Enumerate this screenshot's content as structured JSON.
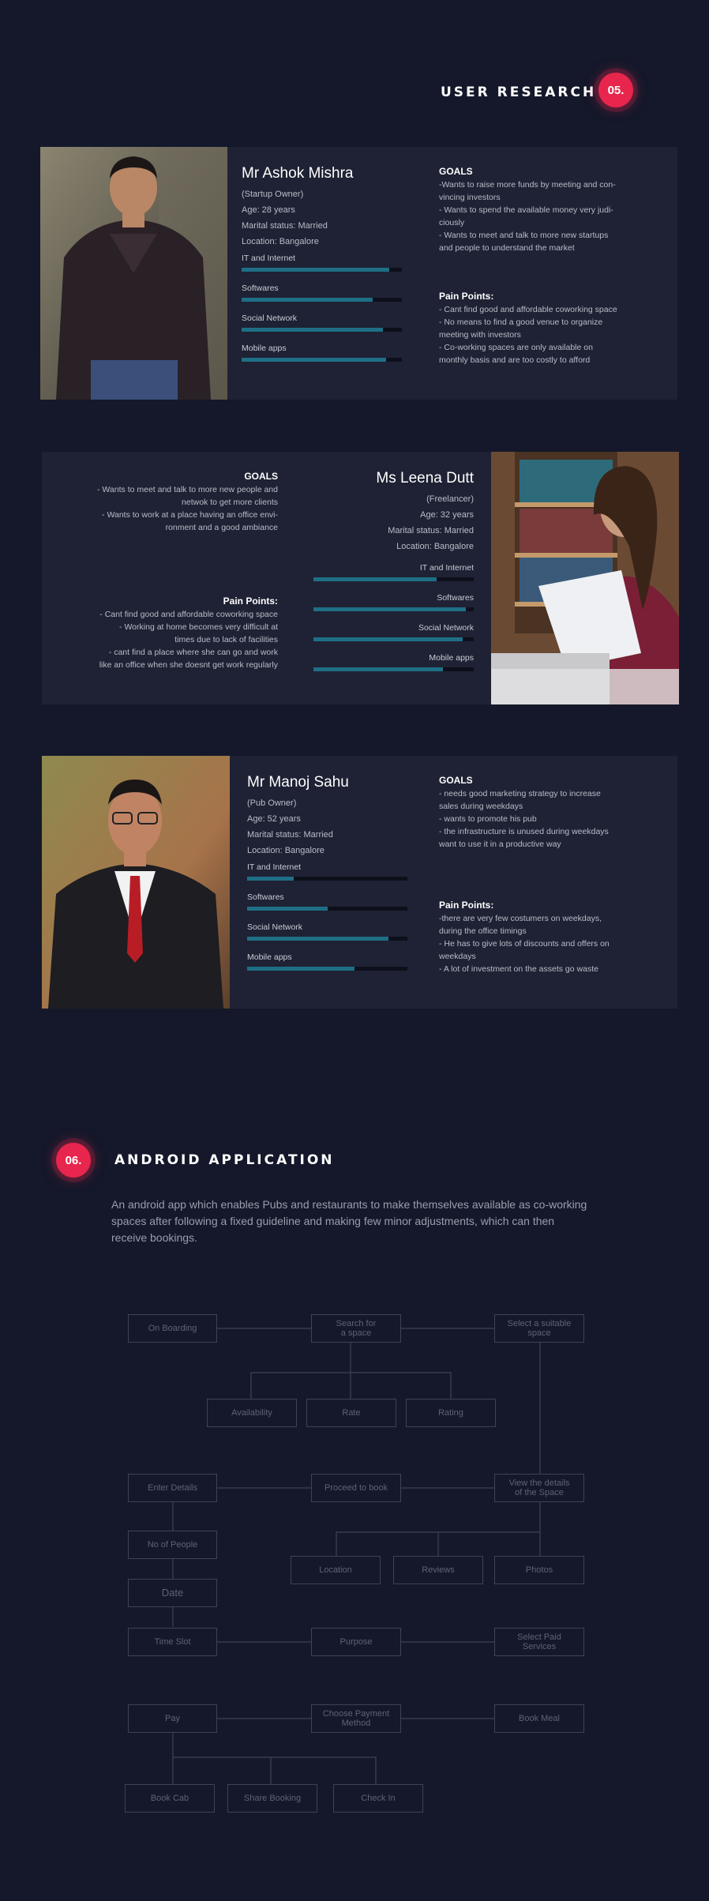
{
  "user_research": {
    "title": "USER RESEARCH",
    "number": "05.",
    "personas": [
      {
        "name": "Mr Ashok Mishra",
        "role": "(Startup Owner)",
        "age": "Age: 28 years",
        "marital": "Marital status: Married",
        "location": "Location: Bangalore",
        "skills": [
          {
            "label": "IT and Internet",
            "level": 0.92
          },
          {
            "label": "Softwares",
            "level": 0.82
          },
          {
            "label": "Social Network",
            "level": 0.88
          },
          {
            "label": "Mobile apps",
            "level": 0.9
          }
        ],
        "goals_title": "GOALS",
        "goals": "-Wants to  raise more funds by meeting and con-\nvincing investors\n- Wants to spend the available money very judi-\nciously\n- Wants to meet and talk to more new startups\nand people to understand the market",
        "pain_title": "Pain Points:",
        "pain": "- Cant find good and affordable coworking space\n- No means to find a good venue to organize\nmeeting with investors\n- Co-working spaces are only available on\nmonthly basis and are too costly to afford"
      },
      {
        "name": "Ms Leena Dutt",
        "role": "(Freelancer)",
        "age": "Age: 32 years",
        "marital": "Marital status: Married",
        "location": "Location: Bangalore",
        "skills": [
          {
            "label": "IT and Internet",
            "level": 0.77
          },
          {
            "label": "Softwares",
            "level": 0.95
          },
          {
            "label": "Social Network",
            "level": 0.93
          },
          {
            "label": "Mobile apps",
            "level": 0.81
          }
        ],
        "goals_title": "GOALS",
        "goals": "- Wants to meet and talk to more new people and\nnetwok to get more clients\n- Wants to work at a place having an office envi-\nronment  and a good ambiance",
        "pain_title": "Pain Points:",
        "pain": "- Cant find good and affordable coworking space\n- Working at home becomes very difficult at\ntimes due to lack of facilities\n- cant find a place where she can go and work\nlike an office when she doesnt get work regularly"
      },
      {
        "name": "Mr Manoj Sahu",
        "role": "(Pub Owner)",
        "age": "Age: 52 years",
        "marital": "Marital status: Married",
        "location": "Location: Bangalore",
        "skills": [
          {
            "label": "IT and Internet",
            "level": 0.29
          },
          {
            "label": "Softwares",
            "level": 0.5
          },
          {
            "label": "Social Network",
            "level": 0.88
          },
          {
            "label": "Mobile apps",
            "level": 0.67
          }
        ],
        "goals_title": "GOALS",
        "goals": "- needs good marketing strategy to increase\nsales during weekdays\n- wants to promote his pub\n- the infrastructure is unused during weekdays\nwant to use it in a productive way",
        "pain_title": "Pain Points:",
        "pain": "-there are very few costumers on weekdays,\nduring the office timings\n- He has to give lots of discounts and offers on\nweekdays\n- A lot of investment on the assets go waste"
      }
    ]
  },
  "android": {
    "number": "06.",
    "title": "ANDROID APPLICATION",
    "intro": "An android app which enables Pubs and restaurants to make themselves available as co-working spaces after following a fixed guideline and making few minor adjustments, which can then receive bookings.",
    "flow": {
      "onboarding": "On Boarding",
      "search": "Search for\na space",
      "select_space": "Select a suitable\nspace",
      "availability": "Availability",
      "rate": "Rate",
      "rating": "Rating",
      "enter_details": "Enter Details",
      "proceed": "Proceed to book",
      "view_details": "View the details\nof the Space",
      "people": "No of People",
      "location": "Location",
      "reviews": "Reviews",
      "photos": "Photos",
      "date": "Date",
      "time_slot": "Time Slot",
      "purpose": "Purpose",
      "paid_services": "Select Paid\nServices",
      "pay": "Pay",
      "payment_method": "Choose Payment\nMethod",
      "book_meal": "Book Meal",
      "book_cab": "Book Cab",
      "share_booking": "Share Booking",
      "check_in": "Check In"
    }
  },
  "colors": {
    "background": "#14182a",
    "card": "#1e2234",
    "accent": "#e8264d",
    "bar": "#1e6f86"
  }
}
